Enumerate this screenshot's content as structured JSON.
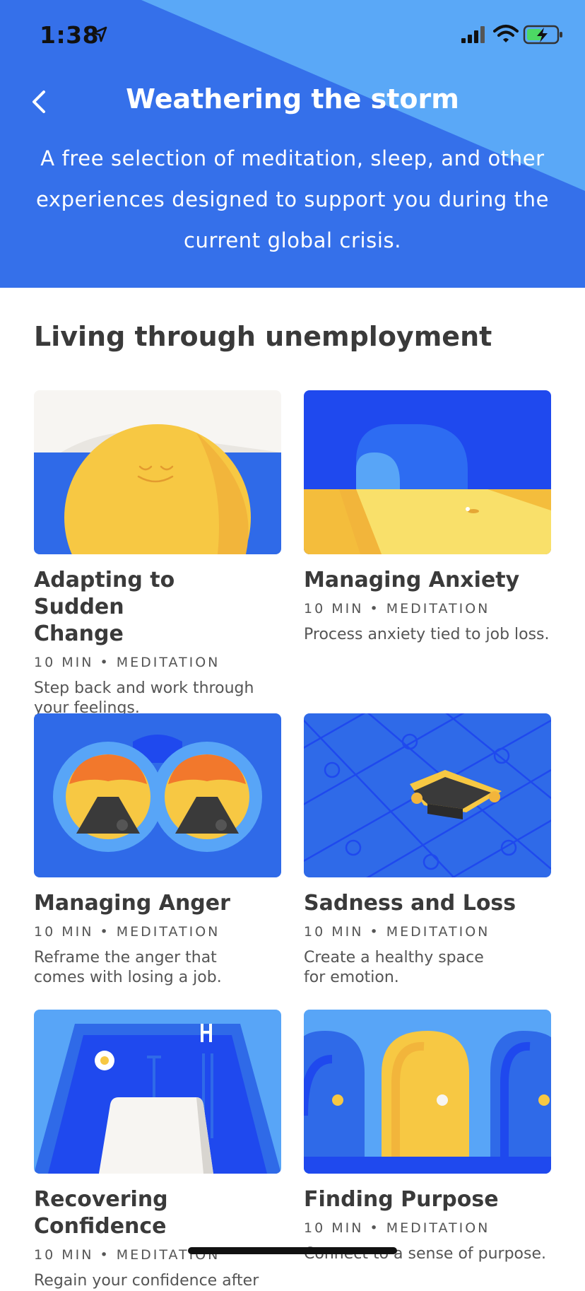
{
  "status_bar": {
    "time": "1:38"
  },
  "header": {
    "title": "Weathering the storm",
    "subtitle": "A free selection of meditation, sleep, and other experiences designed to support you during the current global crisis."
  },
  "section": {
    "title": "Living through unemployment"
  },
  "cards": [
    {
      "title": "Adapting to Sudden Change",
      "meta": "10 MIN • MEDITATION",
      "desc": "Step back and work through your feelings."
    },
    {
      "title": "Managing Anxiety",
      "meta": "10 MIN • MEDITATION",
      "desc": "Process anxiety tied to job loss."
    },
    {
      "title": "Managing Anger",
      "meta": "10 MIN • MEDITATION",
      "desc": "Reframe the anger that comes with losing a job."
    },
    {
      "title": "Sadness and Loss",
      "meta": "10 MIN • MEDITATION",
      "desc": "Create a healthy space for emotion."
    },
    {
      "title": "Recovering Confidence",
      "meta": "10 MIN • MEDITATION",
      "desc": "Regain your confidence after"
    },
    {
      "title": "Finding Purpose",
      "meta": "10 MIN • MEDITATION",
      "desc": "Connect to a sense of purpose."
    }
  ],
  "colors": {
    "hero": "#3570ea",
    "hero_light": "#5aa8f7",
    "yellow": "#f7c843",
    "blue": "#2f6ae8"
  },
  "icons": [
    "location-arrow-icon",
    "cellular-signal-icon",
    "wifi-icon",
    "battery-charging-icon",
    "back-chevron-icon"
  ]
}
